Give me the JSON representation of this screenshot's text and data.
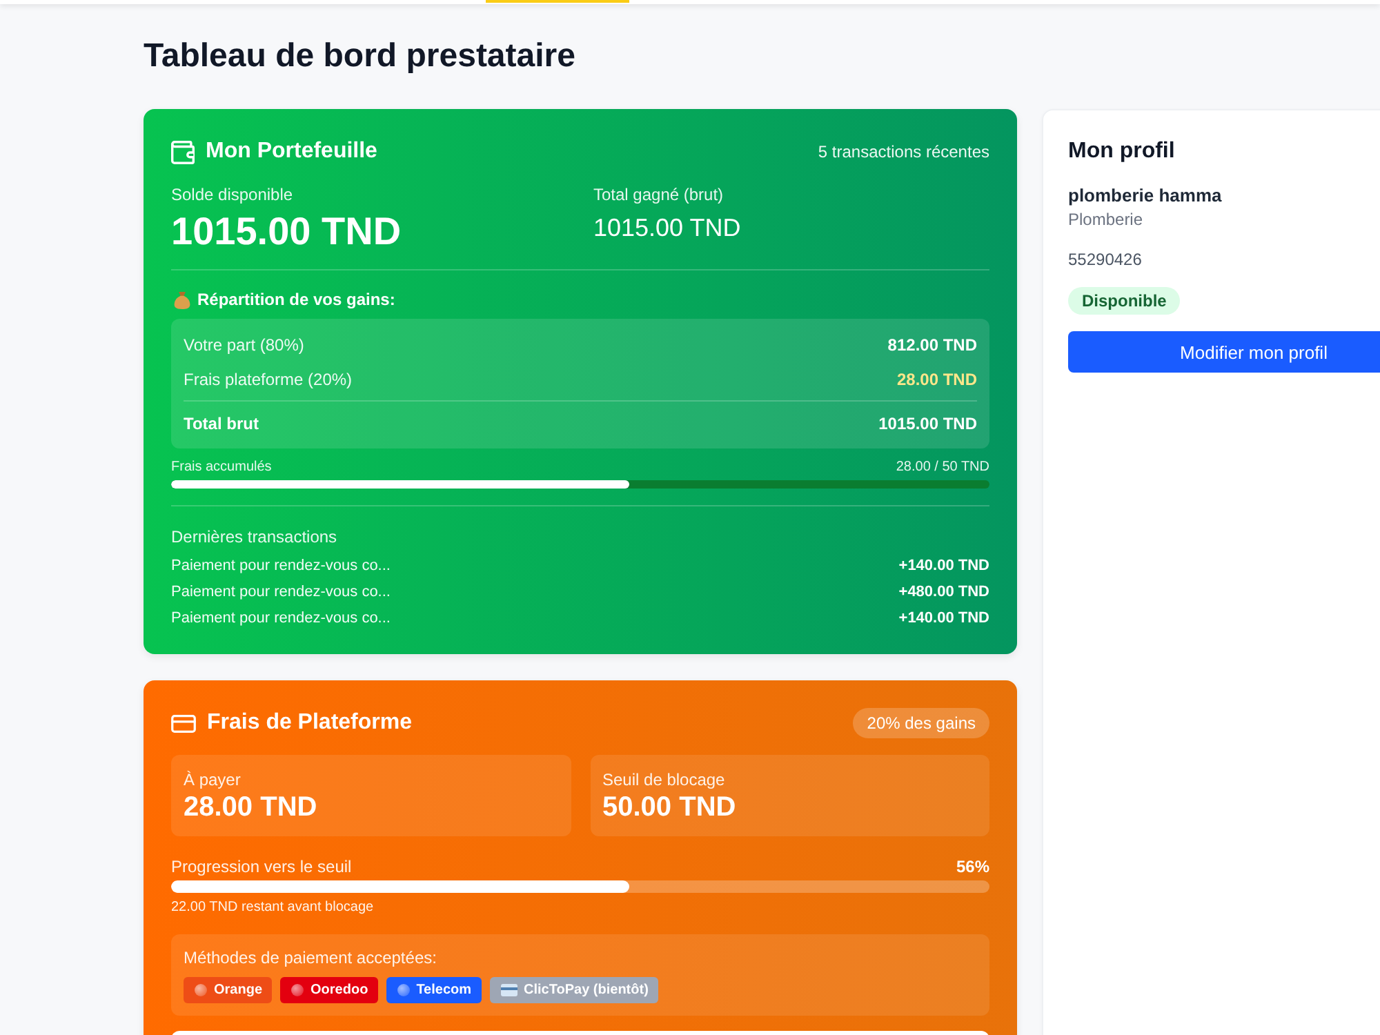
{
  "page": {
    "title": "Tableau de bord prestataire"
  },
  "wallet": {
    "title": "Mon Portefeuille",
    "transactions_count": "5 transactions récentes",
    "balance_label": "Solde disponible",
    "balance": "1015.00 TND",
    "gross_label": "Total gagné (brut)",
    "gross": "1015.00 TND",
    "breakdown": {
      "title": "Répartition de vos gains:",
      "rows": [
        {
          "kind": "share",
          "label": "Votre part (80%)",
          "value": "812.00 TND"
        },
        {
          "kind": "fee",
          "label": "Frais plateforme (20%)",
          "value": "28.00 TND"
        },
        {
          "kind": "total",
          "label": "Total brut",
          "value": "1015.00 TND"
        }
      ]
    },
    "fees_progress": {
      "label": "Frais accumulés",
      "reading": "28.00 / 50 TND",
      "level": 0.56
    },
    "recent": {
      "title": "Dernières transactions",
      "items": [
        {
          "label": "Paiement pour rendez-vous co...",
          "amount": "+140.00 TND"
        },
        {
          "label": "Paiement pour rendez-vous co...",
          "amount": "+480.00 TND"
        },
        {
          "label": "Paiement pour rendez-vous co...",
          "amount": "+140.00 TND"
        }
      ]
    }
  },
  "platform_fees": {
    "title": "Frais de Plateforme",
    "badge": "20% des gains",
    "cards": [
      {
        "label": "À payer",
        "value": "28.00 TND"
      },
      {
        "label": "Seuil de blocage",
        "value": "50.00 TND"
      }
    ],
    "progress": {
      "label": "Progression vers le seuil",
      "reading": "56%",
      "level": 0.56,
      "note": "22.00 TND restant avant blocage"
    },
    "methods": {
      "title": "Méthodes de paiement acceptées:",
      "items": [
        {
          "kind": "dot",
          "label": "Orange",
          "color": "#ee4d16"
        },
        {
          "kind": "dot",
          "label": "Ooredoo",
          "color": "#e3000f"
        },
        {
          "kind": "dot",
          "label": "Telecom",
          "color": "#1a5cff"
        },
        {
          "kind": "card",
          "label": "ClicToPay (bientôt)",
          "color": "#9ea6b4"
        }
      ]
    }
  },
  "profile": {
    "title": "Mon profil",
    "name": "plomberie hamma",
    "category": "Plomberie",
    "phone": "55290426",
    "status": "Disponible",
    "button": "Modifier mon profil"
  }
}
